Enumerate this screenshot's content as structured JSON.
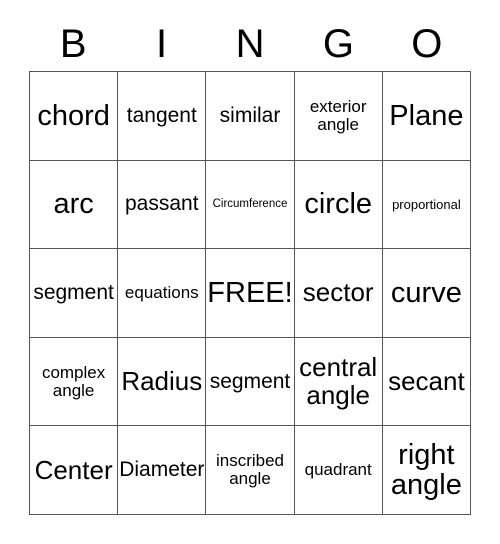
{
  "card": {
    "title_letters": [
      "B",
      "I",
      "N",
      "G",
      "O"
    ],
    "columns": 5,
    "rows": 5,
    "free_space_label": "FREE!",
    "border_color": "#555555",
    "text_color": "#000000",
    "background_color": "#ffffff",
    "cells": [
      [
        {
          "label": "chord",
          "size": "xl"
        },
        {
          "label": "tangent",
          "size": "md"
        },
        {
          "label": "similar",
          "size": "md"
        },
        {
          "label": "exterior\nangle",
          "size": "sm"
        },
        {
          "label": "Plane",
          "size": "xl"
        }
      ],
      [
        {
          "label": "arc",
          "size": "xl"
        },
        {
          "label": "passant",
          "size": "md"
        },
        {
          "label": "Circumference",
          "size": "xxs"
        },
        {
          "label": "circle",
          "size": "xl"
        },
        {
          "label": "proportional",
          "size": "xs"
        }
      ],
      [
        {
          "label": "segment",
          "size": "md"
        },
        {
          "label": "equations",
          "size": "sm"
        },
        {
          "label": "FREE!",
          "size": "xl"
        },
        {
          "label": "sector",
          "size": "lg"
        },
        {
          "label": "curve",
          "size": "xl"
        }
      ],
      [
        {
          "label": "complex\nangle",
          "size": "sm"
        },
        {
          "label": "Radius",
          "size": "lg"
        },
        {
          "label": "segment",
          "size": "md"
        },
        {
          "label": "central\nangle",
          "size": "lg"
        },
        {
          "label": "secant",
          "size": "lg"
        }
      ],
      [
        {
          "label": "Center",
          "size": "lg"
        },
        {
          "label": "Diameter",
          "size": "md"
        },
        {
          "label": "inscribed\nangle",
          "size": "sm"
        },
        {
          "label": "quadrant",
          "size": "sm"
        },
        {
          "label": "right\nangle",
          "size": "xl"
        }
      ]
    ]
  }
}
